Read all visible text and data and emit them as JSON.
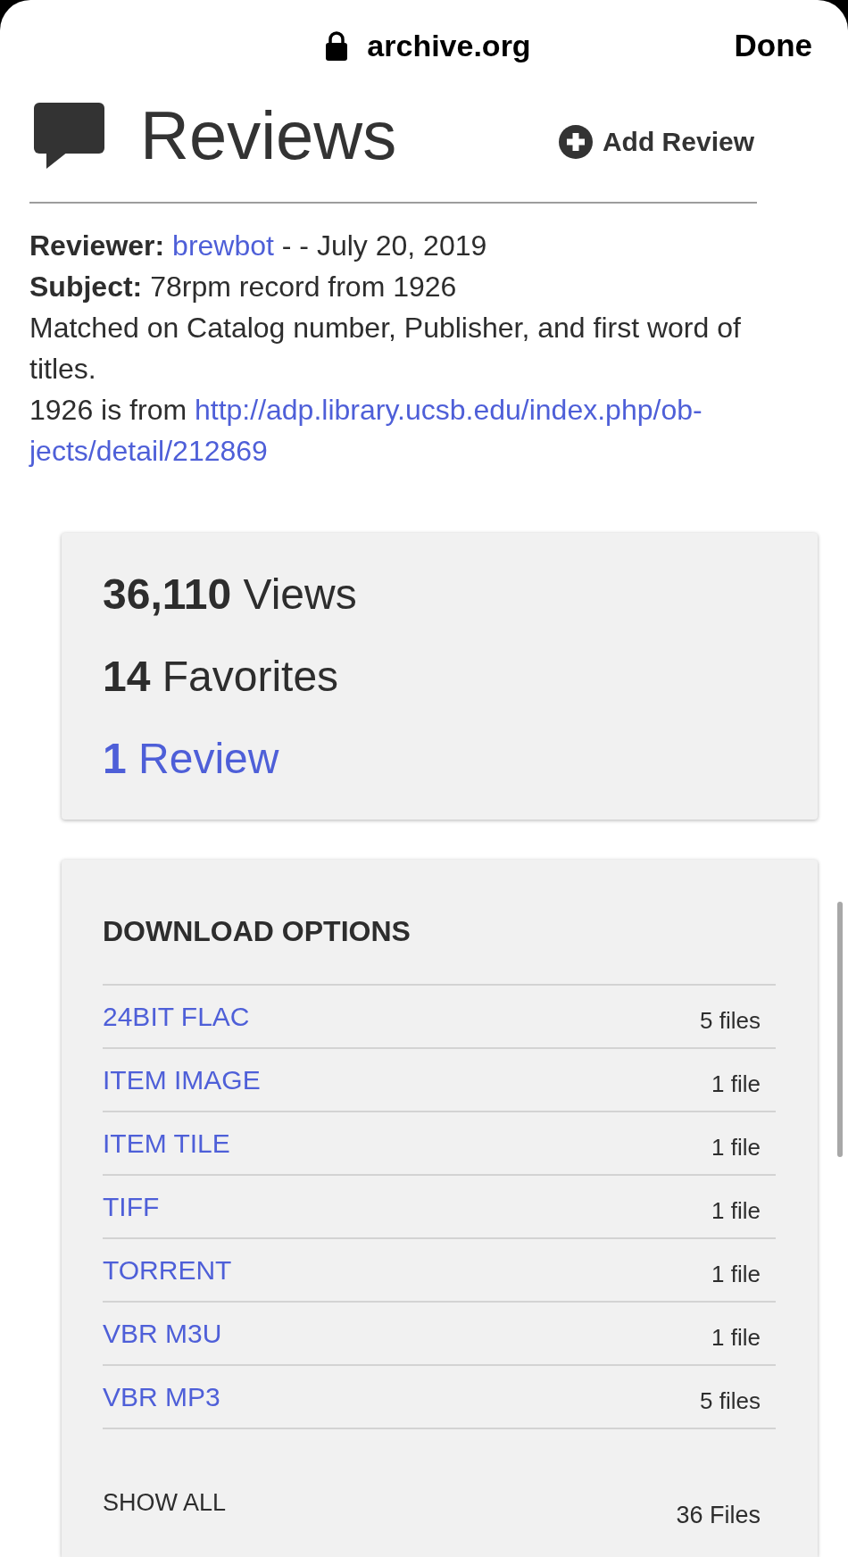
{
  "browser_bar": {
    "domain": "archive.org",
    "done": "Done"
  },
  "reviews": {
    "title": "Reviews",
    "add_button": "Add Review",
    "entries": [
      {
        "reviewer_label": "Reviewer:",
        "reviewer": "brewbot",
        "date": "- - July 20, 2019",
        "subject_label": "Subject:",
        "subject": "78rpm record from 1926",
        "body": "Matched on Catalog number, Publisher, and first word of titles.",
        "source_prefix": "1926 is from",
        "source_url_lines": [
          "http://adp.library.ucsb.edu/index.php/ob-",
          "jects/detail/212869"
        ]
      }
    ]
  },
  "stats": [
    {
      "kind": "text",
      "text": "**36,110** Views"
    },
    {
      "kind": "text",
      "text": "**14** Favorites"
    },
    {
      "kind": "link",
      "text": "**1** Review"
    }
  ],
  "downloads": {
    "title": "DOWNLOAD OPTIONS",
    "options": [
      {
        "label": "24BIT FLAC",
        "count": "5 files"
      },
      {
        "label": "ITEM IMAGE",
        "count": "1 file"
      },
      {
        "label": "ITEM TILE",
        "count": "1 file"
      },
      {
        "label": "TIFF",
        "count": "1 file"
      },
      {
        "label": "TORRENT",
        "count": "1 file"
      },
      {
        "label": "VBR M3U",
        "count": "1 file"
      },
      {
        "label": "VBR MP3",
        "count": "5 files"
      }
    ],
    "show_all": {
      "label": "SHOW ALL",
      "count": "36 Files"
    }
  }
}
